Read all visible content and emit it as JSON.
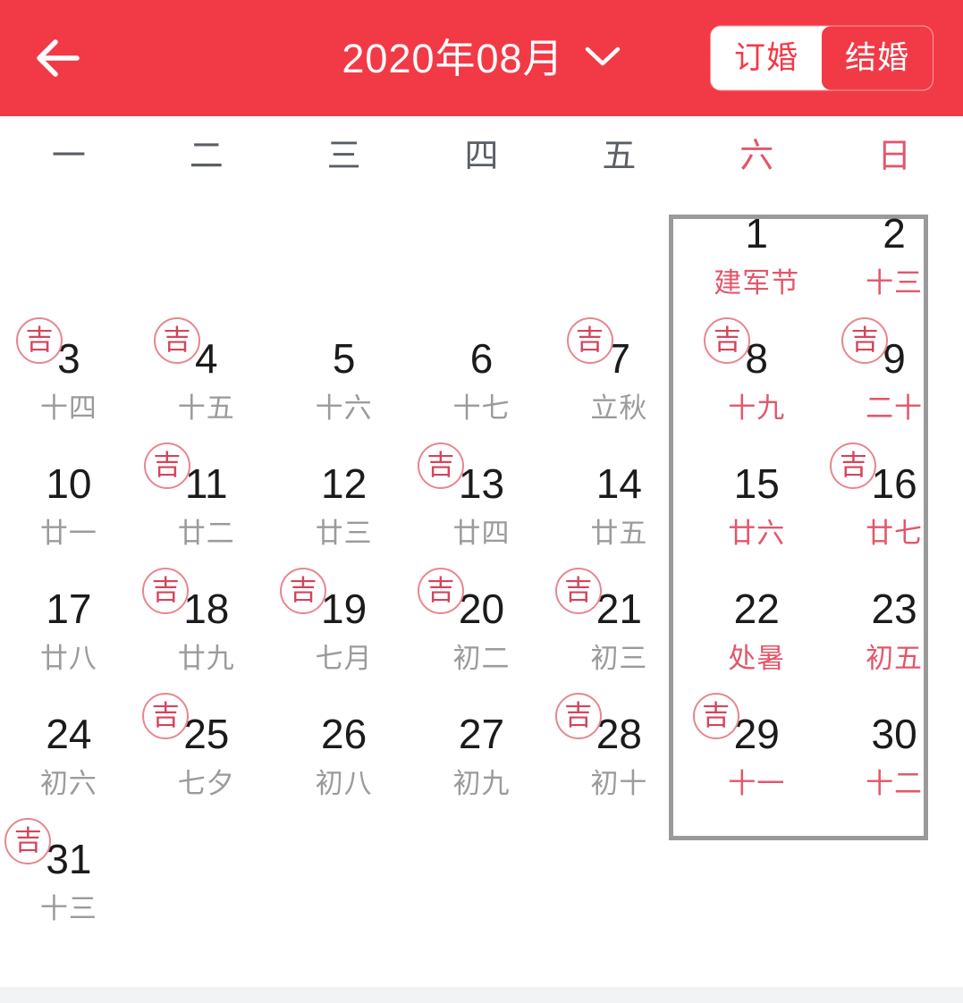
{
  "header": {
    "back_icon": "back-arrow-icon",
    "title": "2020年08月",
    "chevron_icon": "chevron-down-icon",
    "toggle": {
      "engagement_label": "订婚",
      "marriage_label": "结婚",
      "selected": "结婚"
    },
    "background_color": "#f23a47"
  },
  "weekdays": [
    {
      "label": "一",
      "weekend": false
    },
    {
      "label": "二",
      "weekend": false
    },
    {
      "label": "三",
      "weekend": false
    },
    {
      "label": "四",
      "weekend": false
    },
    {
      "label": "五",
      "weekend": false
    },
    {
      "label": "六",
      "weekend": true
    },
    {
      "label": "日",
      "weekend": true
    }
  ],
  "colors": {
    "brand_red": "#f23a47",
    "weekend_red": "#e2576b",
    "badge_red": "#d4455c",
    "day_text": "#1b1b1b",
    "sublabel_gray": "#9b9b9b",
    "highlight_border": "#9a9a9a"
  },
  "badge": {
    "label": "吉"
  },
  "weeks": [
    [
      {
        "empty": true
      },
      {
        "empty": true
      },
      {
        "empty": true
      },
      {
        "empty": true
      },
      {
        "empty": true
      },
      {
        "day": "1",
        "sub": "建军节",
        "badge": false,
        "weekend": true
      },
      {
        "day": "2",
        "sub": "十三",
        "badge": false,
        "weekend": true
      }
    ],
    [
      {
        "day": "3",
        "sub": "十四",
        "badge": true,
        "weekend": false
      },
      {
        "day": "4",
        "sub": "十五",
        "badge": true,
        "weekend": false
      },
      {
        "day": "5",
        "sub": "十六",
        "badge": false,
        "weekend": false
      },
      {
        "day": "6",
        "sub": "十七",
        "badge": false,
        "weekend": false
      },
      {
        "day": "7",
        "sub": "立秋",
        "badge": true,
        "weekend": false
      },
      {
        "day": "8",
        "sub": "十九",
        "badge": true,
        "weekend": true
      },
      {
        "day": "9",
        "sub": "二十",
        "badge": true,
        "weekend": true
      }
    ],
    [
      {
        "day": "10",
        "sub": "廿一",
        "badge": false,
        "weekend": false
      },
      {
        "day": "11",
        "sub": "廿二",
        "badge": true,
        "weekend": false
      },
      {
        "day": "12",
        "sub": "廿三",
        "badge": false,
        "weekend": false
      },
      {
        "day": "13",
        "sub": "廿四",
        "badge": true,
        "weekend": false
      },
      {
        "day": "14",
        "sub": "廿五",
        "badge": false,
        "weekend": false
      },
      {
        "day": "15",
        "sub": "廿六",
        "badge": false,
        "weekend": true
      },
      {
        "day": "16",
        "sub": "廿七",
        "badge": true,
        "weekend": true
      }
    ],
    [
      {
        "day": "17",
        "sub": "廿八",
        "badge": false,
        "weekend": false
      },
      {
        "day": "18",
        "sub": "廿九",
        "badge": true,
        "weekend": false
      },
      {
        "day": "19",
        "sub": "七月",
        "badge": true,
        "weekend": false
      },
      {
        "day": "20",
        "sub": "初二",
        "badge": true,
        "weekend": false
      },
      {
        "day": "21",
        "sub": "初三",
        "badge": true,
        "weekend": false
      },
      {
        "day": "22",
        "sub": "处暑",
        "badge": false,
        "weekend": true
      },
      {
        "day": "23",
        "sub": "初五",
        "badge": false,
        "weekend": true
      }
    ],
    [
      {
        "day": "24",
        "sub": "初六",
        "badge": false,
        "weekend": false
      },
      {
        "day": "25",
        "sub": "七夕",
        "badge": true,
        "weekend": false
      },
      {
        "day": "26",
        "sub": "初八",
        "badge": false,
        "weekend": false
      },
      {
        "day": "27",
        "sub": "初九",
        "badge": false,
        "weekend": false
      },
      {
        "day": "28",
        "sub": "初十",
        "badge": true,
        "weekend": false
      },
      {
        "day": "29",
        "sub": "十一",
        "badge": true,
        "weekend": true
      },
      {
        "day": "30",
        "sub": "十二",
        "badge": false,
        "weekend": true
      }
    ],
    [
      {
        "day": "31",
        "sub": "十三",
        "badge": true,
        "weekend": false
      },
      {
        "empty": true
      },
      {
        "empty": true
      },
      {
        "empty": true
      },
      {
        "empty": true
      },
      {
        "empty": true
      },
      {
        "empty": true
      }
    ]
  ]
}
